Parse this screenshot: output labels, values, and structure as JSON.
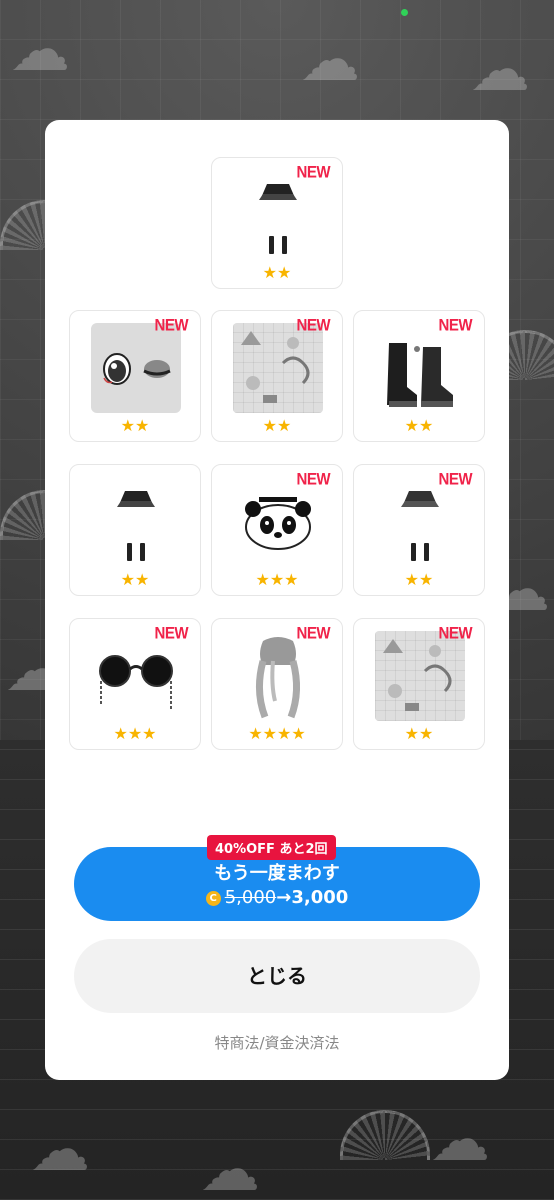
{
  "items": [
    {
      "new_label": "NEW",
      "stars": "★★",
      "type": "skirt-boots-icon"
    },
    {
      "new_label": "NEW",
      "stars": "★★",
      "type": "eye-makeup-icon"
    },
    {
      "new_label": "NEW",
      "stars": "★★",
      "type": "pattern-background-icon"
    },
    {
      "new_label": "NEW",
      "stars": "★★",
      "type": "boots-icon"
    },
    {
      "new_label": "",
      "stars": "★★",
      "type": "skirt-boots-icon"
    },
    {
      "new_label": "NEW",
      "stars": "★★★",
      "type": "panda-icon"
    },
    {
      "new_label": "NEW",
      "stars": "★★",
      "type": "skirt-boots-icon"
    },
    {
      "new_label": "NEW",
      "stars": "★★★",
      "type": "sunglasses-icon"
    },
    {
      "new_label": "NEW",
      "stars": "★★★★",
      "type": "twintail-hair-icon"
    },
    {
      "new_label": "NEW",
      "stars": "★★",
      "type": "pattern-background-icon"
    }
  ],
  "spin_again": {
    "badge": "40%OFF あと2回",
    "label": "もう一度まわす",
    "coin_icon": "coin-icon",
    "old_price": "5,000",
    "arrow": "→",
    "new_price": "3,000",
    "color": "#1a8cf0"
  },
  "close_label": "とじる",
  "legal_link": "特商法/資金決済法",
  "colors": {
    "new_badge": "#f0234a",
    "star": "#f8b400",
    "discount_badge": "#e8143f"
  }
}
